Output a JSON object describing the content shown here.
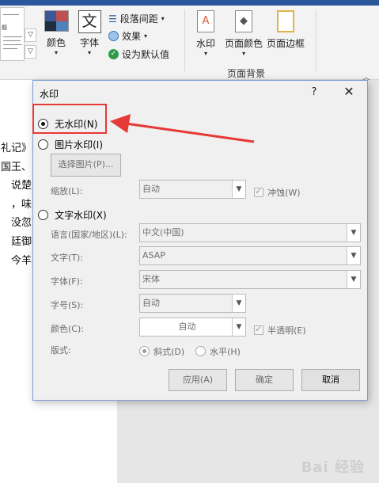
{
  "ribbon": {
    "colors_label": "颜色",
    "fonts_label": "字体",
    "font_glyph": "文",
    "paragraph_spacing": "段落间距",
    "effects": "效果",
    "set_default": "设为默认值",
    "watermark_label": "水印",
    "page_color_label": "页面颜色",
    "page_border_label": "页面边框",
    "group_label": "页面背景",
    "theme_colors": [
      "#3b5998",
      "#c0504d",
      "#1f2d3d",
      "#4f81bd"
    ]
  },
  "document": {
    "lines": [
      "礼记》",
      "国王、",
      "说楚",
      "，味",
      "没忽",
      "廷御",
      "今羊"
    ]
  },
  "dialog": {
    "title": "水印",
    "help": "?",
    "close": "✕",
    "no_watermark": "无水印(N)",
    "picture_watermark": "图片水印(I)",
    "select_picture": "选择图片(P)...",
    "scale_label": "缩放(L):",
    "scale_value": "自动",
    "washout": "冲蚀(W)",
    "text_watermark": "文字水印(X)",
    "language_label": "语言(国家/地区)(L):",
    "language_value": "中文(中国)",
    "text_label": "文字(T):",
    "text_value": "ASAP",
    "font_label": "字体(F):",
    "font_value": "宋体",
    "size_label": "字号(S):",
    "size_value": "自动",
    "color_label": "颜色(C):",
    "color_value": "自动",
    "semitransparent": "半透明(E)",
    "layout_label": "版式:",
    "diagonal": "斜式(D)",
    "horizontal": "水平(H)",
    "apply": "应用(A)",
    "ok": "确定",
    "cancel": "取消"
  },
  "annotation_color": "#e53935",
  "watermark_text": "Bai 经验"
}
